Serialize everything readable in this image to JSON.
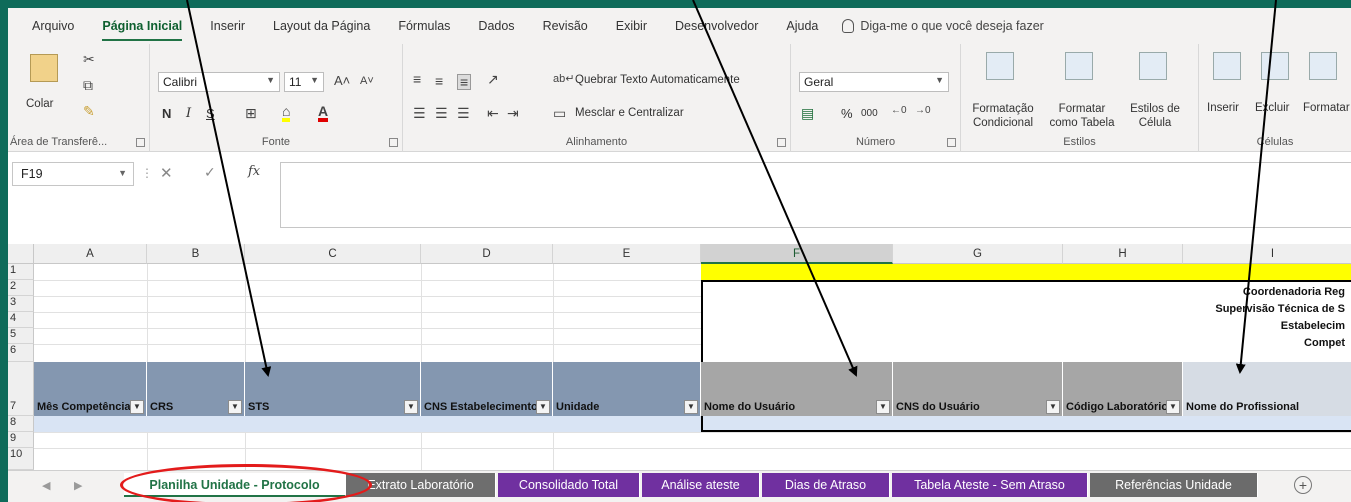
{
  "menu": {
    "items": [
      "Arquivo",
      "Página Inicial",
      "Inserir",
      "Layout da Página",
      "Fórmulas",
      "Dados",
      "Revisão",
      "Exibir",
      "Desenvolvedor",
      "Ajuda"
    ],
    "active": "Página Inicial",
    "tellme": "Diga-me o que você deseja fazer"
  },
  "ribbon": {
    "clipboard": {
      "label": "Área de Transferê...",
      "paste": "Colar"
    },
    "font": {
      "label": "Fonte",
      "name": "Calibri",
      "size": "11",
      "bold": "N",
      "italic": "I",
      "underline": "S"
    },
    "alignment": {
      "label": "Alinhamento",
      "wrap": "Quebrar Texto Automaticamente",
      "merge": "Mesclar e Centralizar"
    },
    "number": {
      "label": "Número",
      "format": "Geral",
      "percent": "%",
      "thousands": "000"
    },
    "styles": {
      "label": "Estilos",
      "conditional": "Formatação Condicional",
      "as_table": "Formatar como Tabela",
      "cell_styles": "Estilos de Célula"
    },
    "cells": {
      "label": "Células",
      "insert": "Inserir",
      "delete": "Excluir",
      "format": "Formatar"
    }
  },
  "formula_bar": {
    "name_box": "F19",
    "fx": "fx",
    "content": ""
  },
  "grid": {
    "columns": [
      "A",
      "B",
      "C",
      "D",
      "E",
      "F",
      "G",
      "H",
      "I"
    ],
    "selected_column": "F",
    "rows": [
      "1",
      "2",
      "3",
      "4",
      "5",
      "6",
      "7",
      "8",
      "9",
      "10"
    ],
    "header_row": [
      "Mês Competência",
      "CRS",
      "STS",
      "CNS Estabelecimento",
      "Unidade",
      "Nome do Usuário",
      "CNS do Usuário",
      "Código Laboratório",
      "Nome do Profissional"
    ],
    "title_lines": [
      "Coordenadoria Reg",
      "Supervisão Técnica de S",
      "Estabelecim",
      "Compet"
    ]
  },
  "sheets": {
    "tabs": [
      "Planilha Unidade - Protocolo",
      "Extrato Laboratório",
      "Consolidado Total",
      "Análise ateste",
      "Dias de Atraso",
      "Tabela Ateste - Sem Atraso",
      "Referências Unidade"
    ],
    "active": "Planilha Unidade - Protocolo"
  },
  "colors": {
    "excel_green": "#217346",
    "header_blue": "#8497b0",
    "header_gray": "#a6a6a6",
    "header_light": "#d6dce4",
    "annotation_red": "#e31b1b"
  }
}
